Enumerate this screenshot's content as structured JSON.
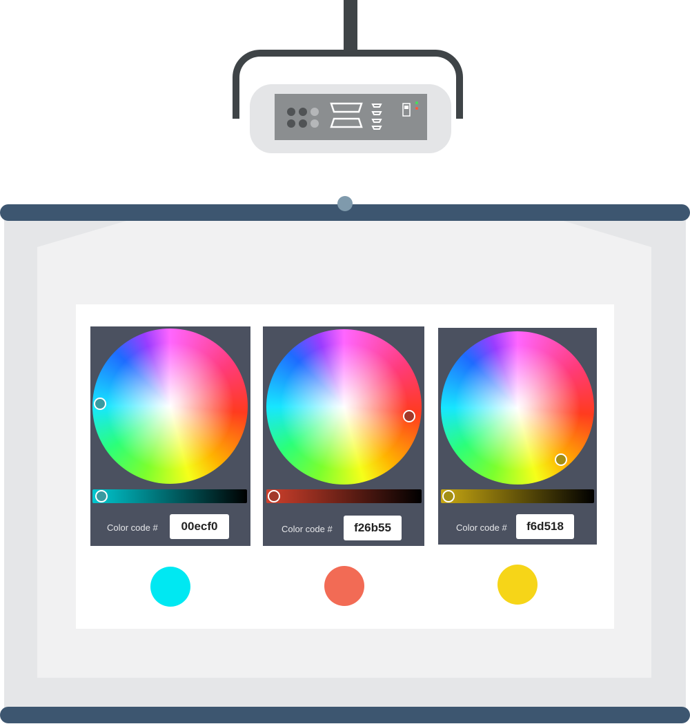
{
  "pickers": [
    {
      "label": "Color code #",
      "code": "00ecf0",
      "color": "#00ecf0",
      "thumb_color": "#3a9aa0",
      "slider_color": "#00c8d0",
      "swatch_color": "#00e8f2"
    },
    {
      "label": "Color code #",
      "code": "f26b55",
      "color": "#f26b55",
      "thumb_color": "#a3392a",
      "slider_color": "#d0402c",
      "swatch_color": "#f26b55"
    },
    {
      "label": "Color code #",
      "code": "f6d518",
      "color": "#f6d518",
      "thumb_color": "#a38f14",
      "slider_color": "#c8a812",
      "swatch_color": "#f6d518"
    }
  ],
  "colors": {
    "screen_frame": "#3d5670",
    "screen_surface": "#e5e6e8",
    "projector_body": "#e4e5e7",
    "projector_panel": "#8b8e90",
    "panel_bg": "#4b5160"
  },
  "icons": [
    "projector-icon",
    "projection-screen-icon"
  ]
}
